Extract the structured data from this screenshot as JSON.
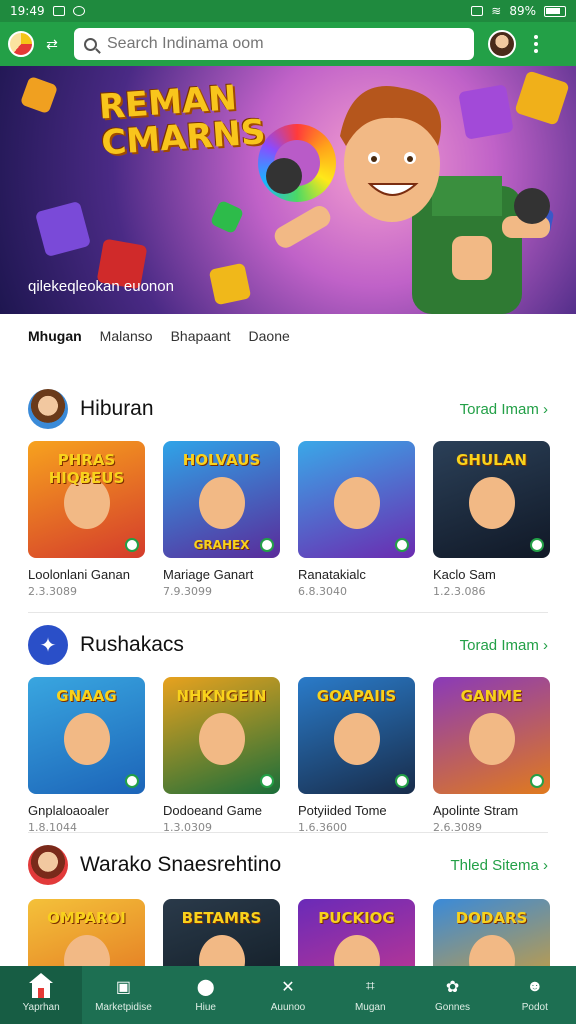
{
  "status_bar": {
    "time": "19:49",
    "battery": "89%"
  },
  "search": {
    "placeholder": "Search Indinama oom"
  },
  "hero": {
    "title": "REMAN CMARNS",
    "caption": "qilekeqleokan euonon"
  },
  "tabs": [
    {
      "label": "Mhugan",
      "active": true
    },
    {
      "label": "Malanso",
      "active": false
    },
    {
      "label": "Bhapaant",
      "active": false
    },
    {
      "label": "Daone",
      "active": false
    }
  ],
  "sections": [
    {
      "title": "Hiburan",
      "more": "Torad Imam",
      "icon": "user-avatar-icon",
      "cards": [
        {
          "name": "Loolonlani Ganan",
          "count": "2.3.3089",
          "art_title": "PHRAS HIQBEUS",
          "colors": [
            "#f7a21e",
            "#d43c2c"
          ]
        },
        {
          "name": "Mariage Ganart",
          "count": "7.9.3099",
          "art_title": "HOLVAUS",
          "art_sub": "GRAHEX",
          "colors": [
            "#2fa4e8",
            "#5a2b9a"
          ]
        },
        {
          "name": "Ranatakialc",
          "count": "6.8.3040",
          "art_title": "",
          "colors": [
            "#3aa8e8",
            "#6b2bb0"
          ]
        },
        {
          "name": "Kaclo Sam",
          "count": "1.2.3.086",
          "art_title": "GHULAN",
          "colors": [
            "#2b4058",
            "#101826"
          ]
        }
      ]
    },
    {
      "title": "Rushakacs",
      "more": "Torad Imam",
      "icon": "game-controller-icon",
      "cards": [
        {
          "name": "Gnplaloaoaler",
          "count": "1.8.1044",
          "art_title": "GNAAG",
          "colors": [
            "#39a6e0",
            "#1c64b8"
          ]
        },
        {
          "name": "Dodoeand Game",
          "count": "1.3.0309",
          "art_title": "NHKNGEIN",
          "colors": [
            "#e8a21e",
            "#1b6e3a"
          ]
        },
        {
          "name": "Potyiided Tome",
          "count": "1.6.3600",
          "art_title": "GOAPAIIS",
          "colors": [
            "#2a7bc9",
            "#182c4a"
          ]
        },
        {
          "name": "Apolinte Stram",
          "count": "2.6.3089",
          "art_title": "GANME",
          "colors": [
            "#8a3ab8",
            "#e07a1e"
          ]
        }
      ]
    },
    {
      "title": "Warako Snaesrehtino",
      "more": "Thled Sitema",
      "icon": "user-avatar-icon",
      "cards": [
        {
          "name": "",
          "count": "",
          "art_title": "OMPAROI",
          "colors": [
            "#f4c13a",
            "#e06a1e"
          ]
        },
        {
          "name": "",
          "count": "",
          "art_title": "BETAMRS",
          "colors": [
            "#2a3a4a",
            "#0e1820"
          ]
        },
        {
          "name": "",
          "count": "",
          "art_title": "PUCKIOG",
          "colors": [
            "#6a2ab8",
            "#d03a8a"
          ]
        },
        {
          "name": "",
          "count": "",
          "art_title": "DODARS",
          "colors": [
            "#3a8ad8",
            "#e8a21e"
          ]
        }
      ]
    }
  ],
  "bottom_nav": [
    {
      "label": "Yaprhan",
      "icon": "home-icon",
      "active": true
    },
    {
      "label": "Marketpidise",
      "icon": "store-icon",
      "active": false
    },
    {
      "label": "Hiue",
      "icon": "location-pin-icon",
      "active": false
    },
    {
      "label": "Auunoo",
      "icon": "controller-icon",
      "active": false
    },
    {
      "label": "Mugan",
      "icon": "frame-icon",
      "active": false
    },
    {
      "label": "Gonnes",
      "icon": "puzzle-icon",
      "active": false
    },
    {
      "label": "Podot",
      "icon": "profile-icon",
      "active": false
    }
  ],
  "colors": {
    "primary": "#23a047",
    "nav_bg": "#1d6f52",
    "hero_title": "#f8c51c"
  }
}
